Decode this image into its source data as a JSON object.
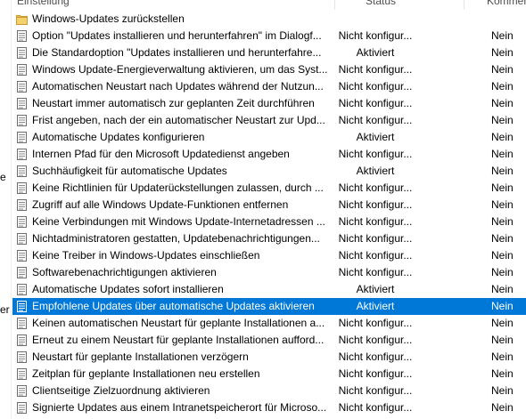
{
  "columns": {
    "setting": "Einstellung",
    "state": "Status",
    "comment": "Kommenta"
  },
  "left_pane": {
    "text_1": "e",
    "text_2": "er"
  },
  "colors": {
    "selection": "#0078d7",
    "folder": "#e8bf4f"
  },
  "rows": [
    {
      "icon": "folder-icon",
      "name": "Windows-Updates zurückstellen",
      "state": "",
      "comment": ""
    },
    {
      "icon": "policy-setting-icon",
      "name": "Option \"Updates installieren und herunterfahren\" im Dialogf...",
      "state": "Nicht konfigur...",
      "comment": "Nein"
    },
    {
      "icon": "policy-setting-icon",
      "name": "Die Standardoption \"Updates installieren und herunterfahre...",
      "state": "Aktiviert",
      "comment": "Nein"
    },
    {
      "icon": "policy-setting-icon",
      "name": "Windows Update-Energieverwaltung aktivieren, um das Syst...",
      "state": "Nicht konfigur...",
      "comment": "Nein"
    },
    {
      "icon": "policy-setting-icon",
      "name": "Automatischen Neustart nach Updates während der Nutzun...",
      "state": "Nicht konfigur...",
      "comment": "Nein"
    },
    {
      "icon": "policy-setting-icon",
      "name": "Neustart immer automatisch zur geplanten Zeit durchführen",
      "state": "Nicht konfigur...",
      "comment": "Nein"
    },
    {
      "icon": "policy-setting-icon",
      "name": "Frist angeben, nach der ein automatischer Neustart zur Upd...",
      "state": "Nicht konfigur...",
      "comment": "Nein"
    },
    {
      "icon": "policy-setting-icon",
      "name": "Automatische Updates konfigurieren",
      "state": "Aktiviert",
      "comment": "Nein"
    },
    {
      "icon": "policy-setting-icon",
      "name": "Internen Pfad für den Microsoft Updatedienst angeben",
      "state": "Nicht konfigur...",
      "comment": "Nein"
    },
    {
      "icon": "policy-setting-icon",
      "name": "Suchhäufigkeit für automatische Updates",
      "state": "Aktiviert",
      "comment": "Nein"
    },
    {
      "icon": "policy-setting-icon",
      "name": "Keine Richtlinien für Updaterückstellungen zulassen, durch ...",
      "state": "Nicht konfigur...",
      "comment": "Nein"
    },
    {
      "icon": "policy-setting-icon",
      "name": "Zugriff auf alle Windows Update-Funktionen entfernen",
      "state": "Nicht konfigur...",
      "comment": "Nein"
    },
    {
      "icon": "policy-setting-icon",
      "name": "Keine Verbindungen mit Windows Update-Internetadressen ...",
      "state": "Nicht konfigur...",
      "comment": "Nein"
    },
    {
      "icon": "policy-setting-icon",
      "name": "Nichtadministratoren gestatten, Updatebenachrichtigungen...",
      "state": "Nicht konfigur...",
      "comment": "Nein"
    },
    {
      "icon": "policy-setting-icon",
      "name": "Keine Treiber in Windows-Updates einschließen",
      "state": "Nicht konfigur...",
      "comment": "Nein"
    },
    {
      "icon": "policy-setting-icon",
      "name": "Softwarebenachrichtigungen aktivieren",
      "state": "Nicht konfigur...",
      "comment": "Nein"
    },
    {
      "icon": "policy-setting-icon",
      "name": "Automatische Updates sofort installieren",
      "state": "Aktiviert",
      "comment": "Nein"
    },
    {
      "icon": "policy-setting-icon",
      "name": "Empfohlene Updates über automatische Updates aktivieren",
      "state": "Aktiviert",
      "comment": "Nein",
      "selected": true
    },
    {
      "icon": "policy-setting-icon",
      "name": "Keinen automatischen Neustart für geplante Installationen a...",
      "state": "Nicht konfigur...",
      "comment": "Nein"
    },
    {
      "icon": "policy-setting-icon",
      "name": "Erneut zu einem Neustart für geplante Installationen aufford...",
      "state": "Nicht konfigur...",
      "comment": "Nein"
    },
    {
      "icon": "policy-setting-icon",
      "name": "Neustart für geplante Installationen verzögern",
      "state": "Nicht konfigur...",
      "comment": "Nein"
    },
    {
      "icon": "policy-setting-icon",
      "name": "Zeitplan für geplante Installationen neu erstellen",
      "state": "Nicht konfigur...",
      "comment": "Nein"
    },
    {
      "icon": "policy-setting-icon",
      "name": "Clientseitige Zielzuordnung aktivieren",
      "state": "Nicht konfigur...",
      "comment": "Nein"
    },
    {
      "icon": "policy-setting-icon",
      "name": "Signierte Updates aus einem Intranetspeicherort für Microso...",
      "state": "Nicht konfigur...",
      "comment": "Nein"
    }
  ]
}
